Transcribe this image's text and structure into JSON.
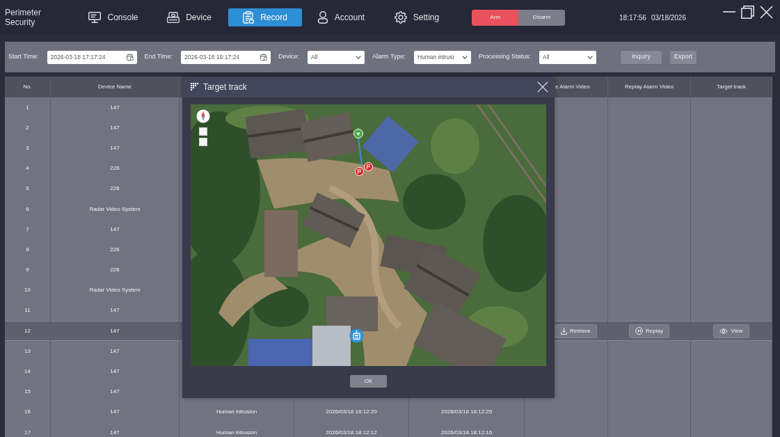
{
  "app": {
    "title": "Perimeter Security"
  },
  "nav": [
    {
      "kind": "console",
      "label": "Console",
      "selected": false
    },
    {
      "kind": "device",
      "label": "Device",
      "selected": false
    },
    {
      "kind": "record",
      "label": "Record",
      "selected": true
    },
    {
      "kind": "account",
      "label": "Account",
      "selected": false
    },
    {
      "kind": "setting",
      "label": "Setting",
      "selected": false
    }
  ],
  "arm_modes": [
    {
      "label": "Arm",
      "selected": true
    },
    {
      "label": "Disarm",
      "selected": false
    }
  ],
  "clock": {
    "time": "18:17:56",
    "date": "03/18/2026"
  },
  "filters": [
    {
      "kind": "datetime",
      "label": "Start Time:",
      "value": "2026-03-18 17:17:24"
    },
    {
      "kind": "datetime",
      "label": "End Time:",
      "value": "2026-03-18 19:17:24"
    },
    {
      "kind": "select",
      "label": "Device:",
      "value": "All"
    },
    {
      "kind": "select",
      "label": "Alarm Type:",
      "value": "Human intrusi"
    },
    {
      "kind": "select",
      "label": "Processing Status:",
      "value": "All"
    }
  ],
  "filter_buttons": [
    "Inquiry",
    "Export"
  ],
  "table": {
    "columns": {
      "no": "No.",
      "device_name": "Device Name",
      "column_6": "e Alarm Video",
      "replay_alarm_video": "Replay Alarm Video",
      "target_track": "Target track"
    },
    "rows": [
      {
        "no": "1",
        "device_name": "147",
        "selected": false
      },
      {
        "no": "2",
        "device_name": "147",
        "selected": false
      },
      {
        "no": "3",
        "device_name": "147",
        "selected": false
      },
      {
        "no": "4",
        "device_name": "226",
        "selected": false
      },
      {
        "no": "5",
        "device_name": "226",
        "selected": false
      },
      {
        "no": "6",
        "device_name": "Radar Video System",
        "selected": false
      },
      {
        "no": "7",
        "device_name": "147",
        "selected": false
      },
      {
        "no": "8",
        "device_name": "226",
        "selected": false
      },
      {
        "no": "9",
        "device_name": "226",
        "selected": false
      },
      {
        "no": "10",
        "device_name": "Radar Video System",
        "selected": false
      },
      {
        "no": "11",
        "device_name": "147",
        "selected": false
      },
      {
        "no": "12",
        "device_name": "147",
        "selected": true,
        "actions": [
          {
            "kind": "retrieve",
            "label": "Retrieve"
          },
          {
            "kind": "replay",
            "label": "Replay"
          },
          {
            "kind": "view",
            "label": "View"
          }
        ]
      },
      {
        "no": "13",
        "device_name": "147",
        "selected": false
      },
      {
        "no": "14",
        "device_name": "147",
        "selected": false
      },
      {
        "no": "15",
        "device_name": "147",
        "selected": false
      },
      {
        "no": "16",
        "device_name": "147",
        "column_3": "Human intrusion",
        "column_4": "2026/03/18 18:12:20",
        "column_5": "2026/03/18 18:12:25",
        "selected": false
      },
      {
        "no": "17",
        "device_name": "147",
        "column_3": "Human intrusion",
        "column_4": "2026/03/18 18:12:12",
        "column_5": "2026/03/18 18:12:16",
        "selected": false
      }
    ]
  },
  "dialog": {
    "title": "Target track",
    "ok_label": "OK"
  }
}
